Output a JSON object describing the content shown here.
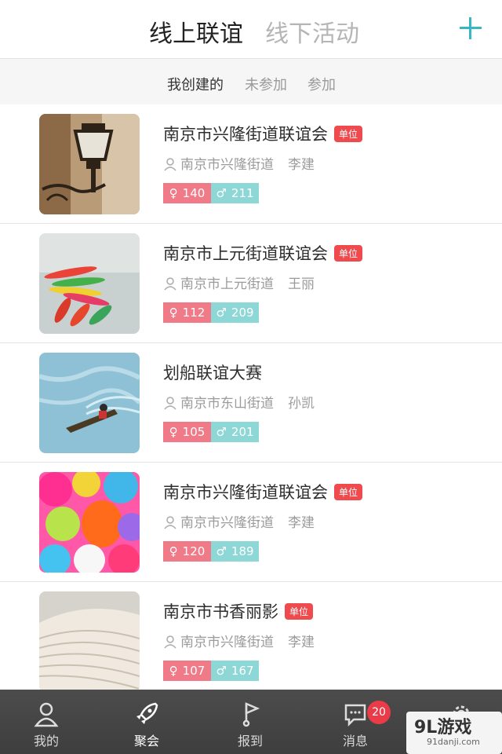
{
  "header": {
    "tab_online": "线上联谊",
    "tab_offline": "线下活动",
    "add_icon": "plus-icon",
    "accent_color": "#35b8c4"
  },
  "subtabs": {
    "created": "我创建的",
    "not_joined": "未参加",
    "joined": "参加"
  },
  "items": [
    {
      "title": "南京市兴隆街道联谊会",
      "badge": "单位",
      "location": "南京市兴隆街道",
      "person": "李建",
      "female_count": "140",
      "male_count": "211",
      "image": "street-lamp"
    },
    {
      "title": "南京市上元街道联谊会",
      "badge": "单位",
      "location": "南京市上元街道",
      "person": "王丽",
      "female_count": "112",
      "male_count": "209",
      "image": "kayaks"
    },
    {
      "title": "划船联谊大赛",
      "badge": "",
      "location": "南京市东山街道",
      "person": "孙凯",
      "female_count": "105",
      "male_count": "201",
      "image": "rowing-boat"
    },
    {
      "title": "南京市兴隆街道联谊会",
      "badge": "单位",
      "location": "南京市兴隆街道",
      "person": "李建",
      "female_count": "120",
      "male_count": "189",
      "image": "colorful-balls"
    },
    {
      "title": "南京市书香丽影",
      "badge": "单位",
      "location": "南京市兴隆街道",
      "person": "李建",
      "female_count": "107",
      "male_count": "167",
      "image": "open-book"
    }
  ],
  "tabbar": {
    "mine": "我的",
    "gather": "聚会",
    "checkin": "报到",
    "messages": "消息",
    "message_badge": "20"
  },
  "watermark": {
    "logo_a": "9L",
    "logo_b": "游戏",
    "url": "91danji.com"
  },
  "colors": {
    "female": "#f07a88",
    "male": "#8ed7d7",
    "badge": "#ef4b4f"
  }
}
